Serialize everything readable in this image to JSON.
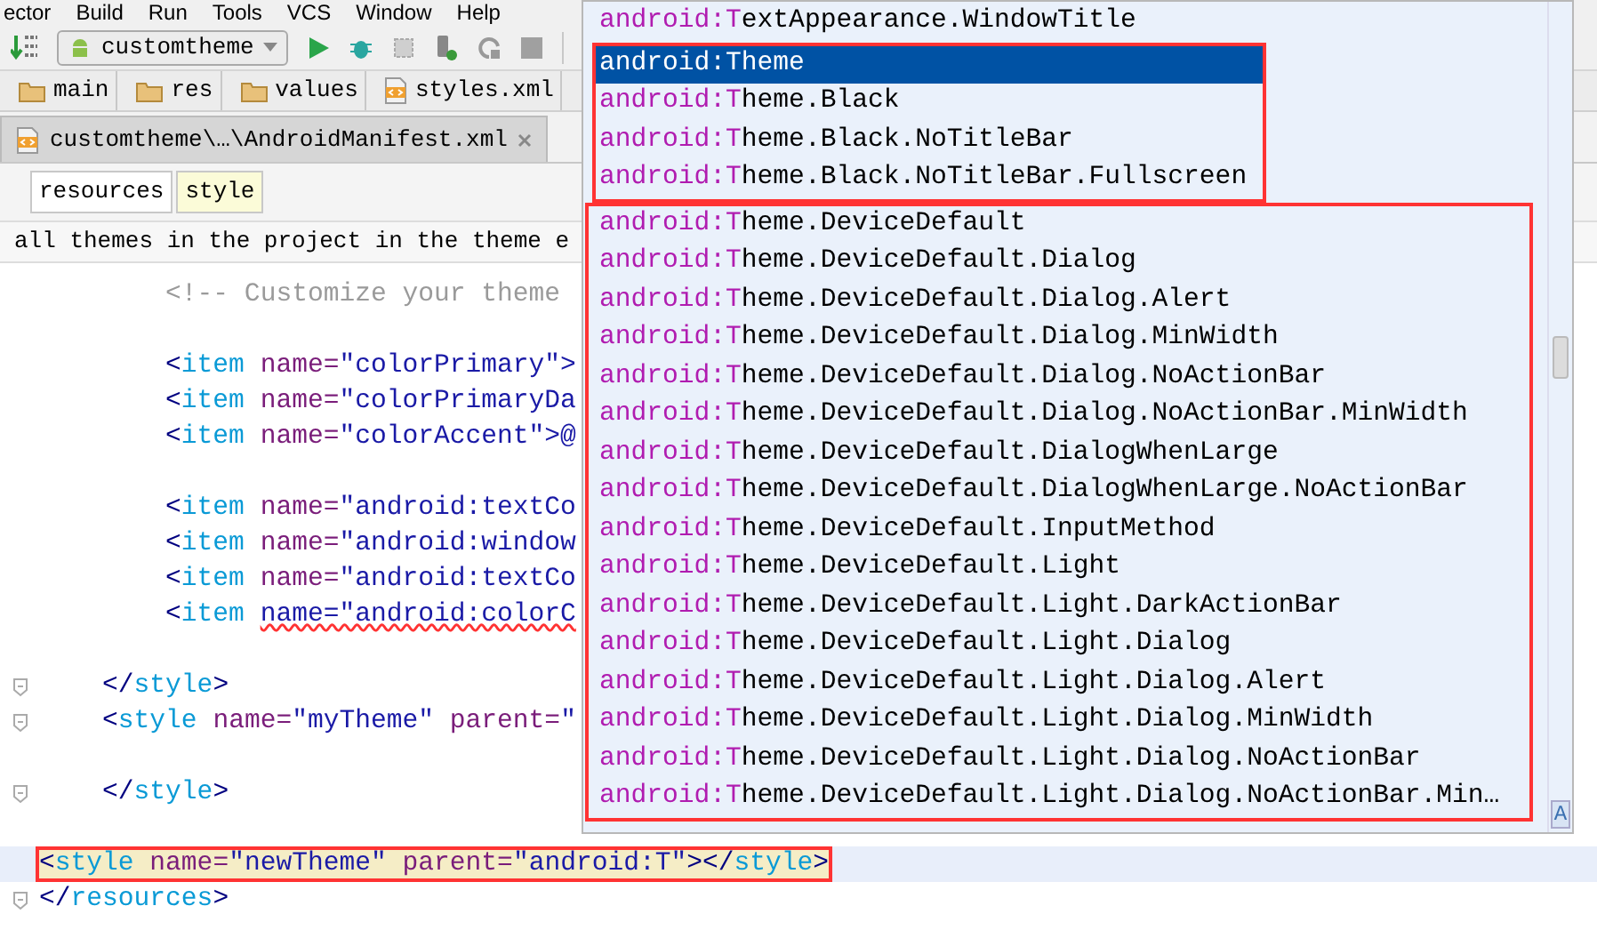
{
  "menu_bar": [
    "ector",
    "Build",
    "Run",
    "Tools",
    "VCS",
    "Window",
    "Help"
  ],
  "toolbar": {
    "run_config": "customtheme"
  },
  "breadcrumbs": [
    "main",
    "res",
    "values",
    "styles.xml"
  ],
  "tabs": [
    {
      "label": "customtheme\\…\\AndroidManifest.xml",
      "selected": true
    }
  ],
  "tag_path": [
    {
      "label": "resources",
      "selected": false
    },
    {
      "label": "style",
      "selected": true
    }
  ],
  "info_bar": "all themes in the project in the theme e",
  "code_lines": [
    {
      "kind": "code",
      "tokens": [
        {
          "kind": "comment",
          "text": "        <!-- Customize your theme"
        }
      ]
    },
    {
      "kind": "blank"
    },
    {
      "kind": "code",
      "tokens": [
        {
          "kind": "bracket",
          "text": "        <"
        },
        {
          "kind": "tag",
          "text": "item "
        },
        {
          "kind": "attr",
          "text": "name="
        },
        {
          "kind": "value",
          "text": "\"colorPrimary\">"
        }
      ]
    },
    {
      "kind": "code",
      "tokens": [
        {
          "kind": "bracket",
          "text": "        <"
        },
        {
          "kind": "tag",
          "text": "item "
        },
        {
          "kind": "attr",
          "text": "name="
        },
        {
          "kind": "value",
          "text": "\"colorPrimaryDa"
        }
      ]
    },
    {
      "kind": "code",
      "tokens": [
        {
          "kind": "bracket",
          "text": "        <"
        },
        {
          "kind": "tag",
          "text": "item "
        },
        {
          "kind": "attr",
          "text": "name="
        },
        {
          "kind": "value",
          "text": "\"colorAccent\">@"
        }
      ]
    },
    {
      "kind": "blank"
    },
    {
      "kind": "code",
      "tokens": [
        {
          "kind": "bracket",
          "text": "        <"
        },
        {
          "kind": "tag",
          "text": "item "
        },
        {
          "kind": "attr",
          "text": "name="
        },
        {
          "kind": "value",
          "text": "\"android:textCo"
        }
      ]
    },
    {
      "kind": "code",
      "tokens": [
        {
          "kind": "bracket",
          "text": "        <"
        },
        {
          "kind": "tag",
          "text": "item "
        },
        {
          "kind": "attr",
          "text": "name="
        },
        {
          "kind": "value",
          "text": "\"android:window"
        }
      ]
    },
    {
      "kind": "code",
      "tokens": [
        {
          "kind": "bracket",
          "text": "        <"
        },
        {
          "kind": "tag",
          "text": "item "
        },
        {
          "kind": "attr",
          "text": "name="
        },
        {
          "kind": "value",
          "text": "\"android:textCo"
        }
      ]
    },
    {
      "kind": "code",
      "tokens": [
        {
          "kind": "bracket",
          "text": "        <"
        },
        {
          "kind": "tag",
          "text": "item "
        },
        {
          "kind": "error",
          "text": "name=\"android:colorC"
        }
      ]
    },
    {
      "kind": "blank"
    },
    {
      "kind": "code",
      "fold": true,
      "tokens": [
        {
          "kind": "bracket",
          "text": "    </"
        },
        {
          "kind": "tag",
          "text": "style"
        },
        {
          "kind": "bracket",
          "text": ">"
        }
      ]
    },
    {
      "kind": "code",
      "fold": true,
      "tokens": [
        {
          "kind": "bracket",
          "text": "    <"
        },
        {
          "kind": "tag",
          "text": "style "
        },
        {
          "kind": "attr",
          "text": "name="
        },
        {
          "kind": "value",
          "text": "\"myTheme\" "
        },
        {
          "kind": "attr",
          "text": "parent="
        },
        {
          "kind": "value",
          "text": "\""
        }
      ]
    },
    {
      "kind": "blank"
    },
    {
      "kind": "code",
      "fold": true,
      "tokens": [
        {
          "kind": "bracket",
          "text": "    </"
        },
        {
          "kind": "tag",
          "text": "style"
        },
        {
          "kind": "bracket",
          "text": ">"
        }
      ]
    },
    {
      "kind": "blank"
    },
    {
      "kind": "code",
      "current": true,
      "tokens": [
        {
          "kind": "bracket",
          "text": "<"
        },
        {
          "kind": "tag",
          "text": "style "
        },
        {
          "kind": "attr",
          "text": "name="
        },
        {
          "kind": "value",
          "text": "\"newTheme\" "
        },
        {
          "kind": "attr",
          "text": "parent="
        },
        {
          "kind": "value",
          "text": "\"android:T\""
        },
        {
          "kind": "bracket",
          "text": "></"
        },
        {
          "kind": "tag",
          "text": "style"
        },
        {
          "kind": "bracket",
          "text": ">"
        }
      ]
    },
    {
      "kind": "code",
      "fold": true,
      "tokens": [
        {
          "kind": "bracket",
          "text": "</"
        },
        {
          "kind": "tag",
          "text": "resources"
        },
        {
          "kind": "bracket",
          "text": ">"
        }
      ]
    }
  ],
  "completion": {
    "items": [
      {
        "match": "android:T",
        "rest": "extAppearance.WindowTitle",
        "selected": false
      },
      {
        "match": "android:T",
        "rest": "heme",
        "selected": true
      },
      {
        "match": "android:T",
        "rest": "heme.Black",
        "selected": false
      },
      {
        "match": "android:T",
        "rest": "heme.Black.NoTitleBar",
        "selected": false
      },
      {
        "match": "android:T",
        "rest": "heme.Black.NoTitleBar.Fullscreen",
        "selected": false
      },
      {
        "match": "android:T",
        "rest": "heme.DeviceDefault",
        "selected": false
      },
      {
        "match": "android:T",
        "rest": "heme.DeviceDefault.Dialog",
        "selected": false
      },
      {
        "match": "android:T",
        "rest": "heme.DeviceDefault.Dialog.Alert",
        "selected": false
      },
      {
        "match": "android:T",
        "rest": "heme.DeviceDefault.Dialog.MinWidth",
        "selected": false
      },
      {
        "match": "android:T",
        "rest": "heme.DeviceDefault.Dialog.NoActionBar",
        "selected": false
      },
      {
        "match": "android:T",
        "rest": "heme.DeviceDefault.Dialog.NoActionBar.MinWidth",
        "selected": false
      },
      {
        "match": "android:T",
        "rest": "heme.DeviceDefault.DialogWhenLarge",
        "selected": false
      },
      {
        "match": "android:T",
        "rest": "heme.DeviceDefault.DialogWhenLarge.NoActionBar",
        "selected": false
      },
      {
        "match": "android:T",
        "rest": "heme.DeviceDefault.InputMethod",
        "selected": false
      },
      {
        "match": "android:T",
        "rest": "heme.DeviceDefault.Light",
        "selected": false
      },
      {
        "match": "android:T",
        "rest": "heme.DeviceDefault.Light.DarkActionBar",
        "selected": false
      },
      {
        "match": "android:T",
        "rest": "heme.DeviceDefault.Light.Dialog",
        "selected": false
      },
      {
        "match": "android:T",
        "rest": "heme.DeviceDefault.Light.Dialog.Alert",
        "selected": false
      },
      {
        "match": "android:T",
        "rest": "heme.DeviceDefault.Light.Dialog.MinWidth",
        "selected": false
      },
      {
        "match": "android:T",
        "rest": "heme.DeviceDefault.Light.Dialog.NoActionBar",
        "selected": false
      },
      {
        "match": "android:T",
        "rest": "heme.DeviceDefault.Light.Dialog.NoActionBar.Min…",
        "selected": false
      }
    ],
    "sort_badge": "A"
  }
}
